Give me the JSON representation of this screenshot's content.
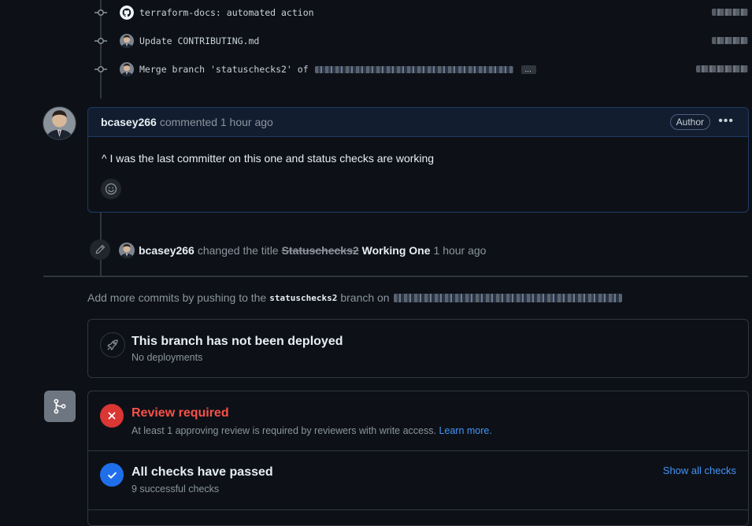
{
  "commits": [
    {
      "icon": "github-icon",
      "message": "terraform-docs: automated action"
    },
    {
      "icon": "avatar",
      "message": "Update CONTRIBUTING.md"
    },
    {
      "icon": "avatar",
      "message": "Merge branch 'statuschecks2' of",
      "has_ellipsis": true,
      "ellipsis_label": "…"
    }
  ],
  "comment": {
    "author": "bcasey266",
    "meta": "commented 1 hour ago",
    "badge": "Author",
    "more_label": "•••",
    "body": "^ I was the last committer on this one and status checks are working"
  },
  "title_event": {
    "actor": "bcasey266",
    "action": "changed the title",
    "old_title": "Statuschecks2",
    "new_title": "Working One",
    "time": "1 hour ago"
  },
  "push_hint": {
    "prefix": "Add more commits by pushing to the",
    "branch": "statuschecks2",
    "suffix": "branch on"
  },
  "deployment": {
    "title": "This branch has not been deployed",
    "subtitle": "No deployments"
  },
  "review": {
    "title": "Review required",
    "subtitle": "At least 1 approving review is required by reviewers with write access.",
    "link": "Learn more."
  },
  "checks": {
    "title": "All checks have passed",
    "subtitle": "9 successful checks",
    "action": "Show all checks"
  },
  "colors": {
    "background": "#0d1117",
    "danger": "#da3633",
    "danger_text": "#f85149",
    "success_blue": "#1f6feb",
    "link": "#4493f8"
  }
}
